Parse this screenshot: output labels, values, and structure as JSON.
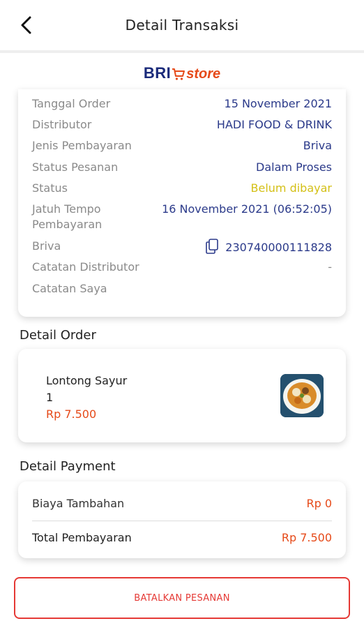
{
  "header": {
    "title": "Detail Transaksi",
    "back_icon": "chevron-left-icon"
  },
  "brand": {
    "bri": "BRI",
    "store": "store"
  },
  "info": {
    "rows": [
      {
        "label": "Tanggal Order",
        "value": "15 November 2021"
      },
      {
        "label": "Distributor",
        "value": "HADI FOOD & DRINK"
      },
      {
        "label": "Jenis Pembayaran",
        "value": "Briva"
      },
      {
        "label": "Status Pesanan",
        "value": "Dalam Proses"
      },
      {
        "label": "Status",
        "value": "Belum dibayar"
      },
      {
        "label": "Jatuh Tempo",
        "label2": "Pembayaran",
        "value": "16 November 2021 (06:52:05)"
      },
      {
        "label": "Briva",
        "value": "230740000111828"
      },
      {
        "label": "Catatan Distributor",
        "value": "-"
      },
      {
        "label": "Catatan Saya",
        "value": ""
      }
    ]
  },
  "order": {
    "section_title": "Detail Order",
    "item": {
      "name": "Lontong Sayur",
      "qty": "1",
      "price": "Rp 7.500"
    }
  },
  "payment": {
    "section_title": "Detail Payment",
    "extra_label": "Biaya Tambahan",
    "extra_value": "Rp 0",
    "total_label": "Total Pembayaran",
    "total_value": "Rp 7.500"
  },
  "actions": {
    "cancel_label": "BATALKAN PESANAN"
  },
  "colors": {
    "accent_red": "#e53935",
    "price_orange": "#e64a19",
    "value_blue": "#2b3a8a",
    "status_yellow": "#d4c017"
  }
}
